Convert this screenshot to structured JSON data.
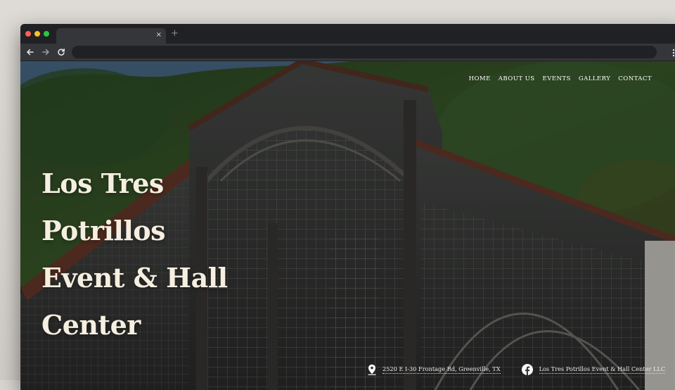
{
  "browser": {
    "traffic_lights": {
      "close": "#ff5f57",
      "minimize": "#febc2e",
      "maximize": "#28c840"
    },
    "tab_close_glyph": "×",
    "new_tab_glyph": "+",
    "url": "",
    "icons": {
      "back": "arrow-left-icon",
      "forward": "arrow-right-icon",
      "reload": "reload-icon",
      "menu": "kebab-menu-icon"
    }
  },
  "nav": {
    "items": [
      "HOME",
      "ABOUT US",
      "EVENTS",
      "GALLERY",
      "CONTACT"
    ]
  },
  "hero": {
    "title_lines": [
      "Los Tres",
      "Potrillos",
      "Event & Hall",
      "Center"
    ]
  },
  "footer": {
    "address": {
      "icon": "map-pin-icon",
      "text": "2520 E I-30 Frontage Rd, Greenville, TX"
    },
    "facebook": {
      "icon": "facebook-icon",
      "text": "Los Tres Potrillos Event & Hall Center LLC"
    }
  },
  "colors": {
    "headline": "#f6efe1",
    "nav_text": "#ffffff",
    "browser_chrome": "#202124",
    "toolbar": "#35363a"
  }
}
